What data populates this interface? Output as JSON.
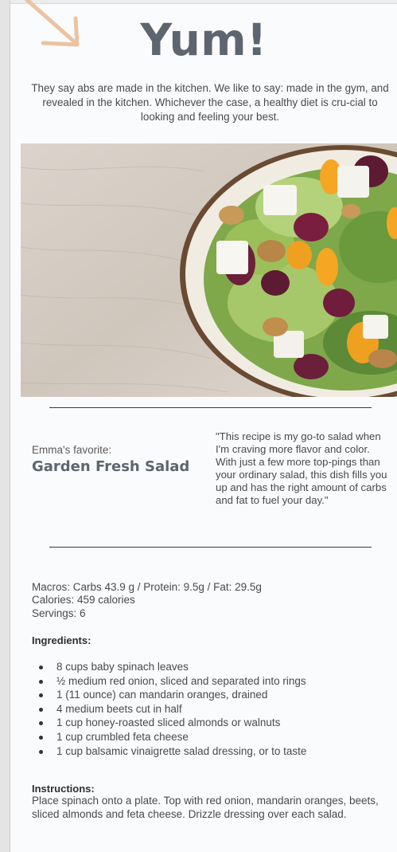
{
  "page": {
    "title": "Yum!",
    "intro": "They say abs are made in the kitchen. We like to say: made in the gym, and revealed in the kitchen. Whichever the case, a healthy diet is cru-cial to looking and feeling your best."
  },
  "hero_image": {
    "alt": "Garden Fresh Salad"
  },
  "favorite": {
    "label": "Emma's favorite:",
    "title": "Garden Fresh Salad"
  },
  "quote": "\"This recipe is my go-to salad when I'm craving more flavor and color. With just a few more top-pings than your ordinary salad, this dish fills you up and has the right amount of carbs and fat to fuel your day.\"",
  "nutrition": {
    "macros": "Macros: Carbs 43.9 g / Protein: 9.5g / Fat: 29.5g",
    "calories": "Calories: 459 calories",
    "servings": "Servings: 6"
  },
  "ingredients": {
    "heading": "Ingredients:",
    "items": [
      "8 cups baby spinach leaves",
      "½ medium red onion, sliced and separated into rings",
      "1 (11 ounce) can mandarin oranges, drained",
      "4 medium beets cut in half",
      "1 cup honey-roasted sliced almonds or walnuts",
      "1 cup crumbled feta cheese",
      "1 cup balsamic vinaigrette salad dressing, or to taste"
    ]
  },
  "instructions": {
    "heading": "Instructions:",
    "text": "Place spinach onto a plate. Top with red onion, mandarin oranges, beets, sliced almonds and feta cheese. Drizzle dressing over each salad."
  },
  "colors": {
    "title": "#5d6570",
    "body_text": "#4a4a4a",
    "arrow": "#ebc3a2",
    "background": "#fafbfc"
  }
}
